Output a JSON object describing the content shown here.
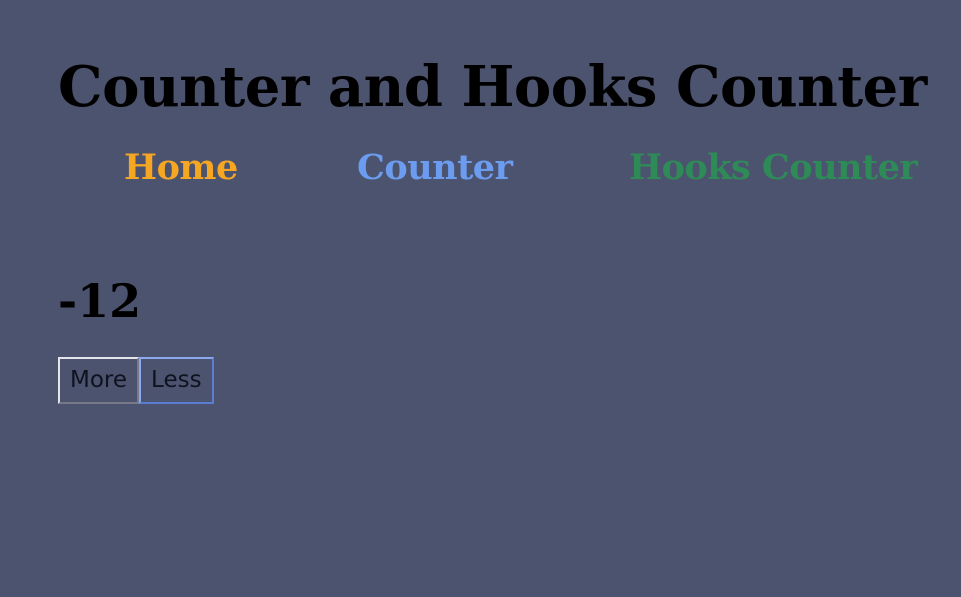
{
  "app": {
    "title": "Counter and Hooks Counter"
  },
  "nav": {
    "items": [
      {
        "label": "Home",
        "color": "#f5a623"
      },
      {
        "label": "Counter",
        "color": "#6c9cf0"
      },
      {
        "label": "Hooks Counter",
        "color": "#2e8b57"
      }
    ]
  },
  "counter": {
    "value": "-12",
    "more_label": "More",
    "less_label": "Less"
  },
  "colors": {
    "background": "#4c536e",
    "text": "#000000"
  }
}
